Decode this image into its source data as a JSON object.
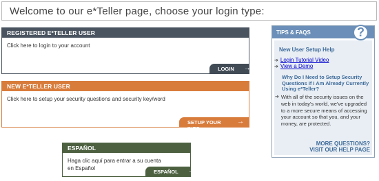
{
  "welcome": "Welcome to our e*Teller page, choose your login type:",
  "registered": {
    "header": "REGISTERED E*TELLER USER",
    "text": "Click here to login to your account",
    "button": "LOGIN",
    "arrow": "→"
  },
  "new_user": {
    "header": "NEW E*TELLER USER",
    "text": "Click here to setup your security questions and security key/word",
    "button": "SETUP YOUR INFO",
    "arrow": "→"
  },
  "espanol": {
    "header": "ESPAÑOL",
    "text": "Haga clic aquí para entrar a su cuenta en Español",
    "button": "ESPAÑOL",
    "arrow": "→"
  },
  "tips": {
    "header": "TIPS & FAQS",
    "badge": "?",
    "new_user_title": "New User Setup Help",
    "links": [
      "Login Tutorial Video",
      "View a Demo"
    ],
    "bullet": "➔",
    "why_title": "Why Do I Need to Setup Security Questions If I Am Already Currently Using e*Teller?",
    "why_answer": "With all of the security issues on the web in today's world, we've upgraded to a more secure means of accessing your account so that you, and your money, are protected.",
    "more_line1": "MORE QUESTIONS?",
    "more_line2": "VISIT OUR HELP PAGE"
  },
  "colors": {
    "registered": "#4a5460",
    "new_user": "#d87c3c",
    "espanol": "#4d6141",
    "tips": "#6b8fb8"
  }
}
